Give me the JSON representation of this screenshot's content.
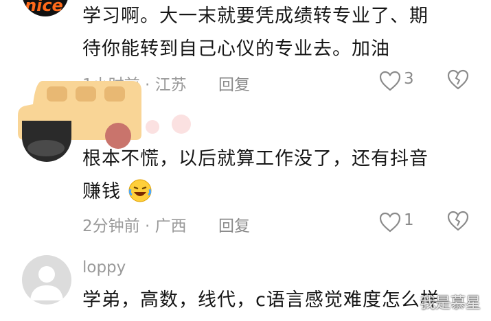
{
  "comments": [
    {
      "avatar_text": "nice.",
      "text_lines": [
        "学习啊。大一末就要凭成绩转专业了、期",
        "待你能转到自己心仪的专业去。加油"
      ],
      "time_place": "1小时前 · 江苏",
      "reply": "回复",
      "likes": "3"
    },
    {
      "text_lines": [
        "根本不慌，以后就算工作没了，还有抖音",
        "赚钱"
      ],
      "time_place": "2分钟前 · 广西",
      "reply": "回复",
      "likes": "1"
    },
    {
      "username": "loppy",
      "text_lines": [
        "学弟，高数，线代，c语言感觉难度怎么样"
      ]
    }
  ],
  "watermark": "我是慕星",
  "colors": {
    "bus": "#f9d596",
    "wheel": "#c9746c",
    "text": "#161616",
    "meta": "#9a9a9a"
  }
}
